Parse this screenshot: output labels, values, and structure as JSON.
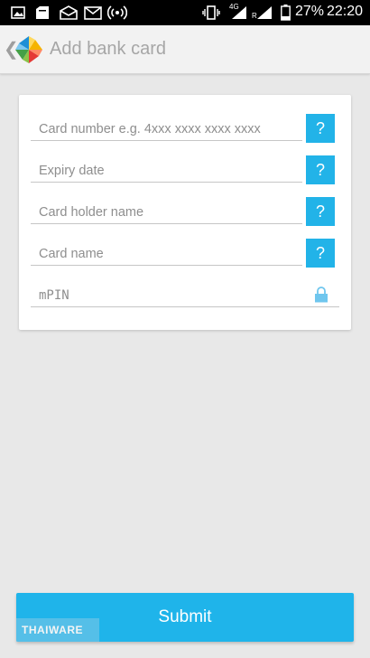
{
  "status_bar": {
    "icons": [
      "image-icon",
      "notification-icon",
      "mail-open-icon",
      "mail-icon",
      "hotspot-icon",
      "vibrate-icon",
      "signal-4g-icon",
      "signal-roaming-icon",
      "battery-icon"
    ],
    "net_4g": "4G",
    "roaming": "R",
    "battery": "27%",
    "time": "22:20"
  },
  "header": {
    "back_icon": "chevron-left-icon",
    "logo_icon": "pinwheel-logo-icon",
    "title": "Add bank card"
  },
  "form": {
    "fields": [
      {
        "placeholder": "Card number e.g. 4xxx xxxx xxxx xxxx",
        "help_label": "?"
      },
      {
        "placeholder": "Expiry date",
        "help_label": "?"
      },
      {
        "placeholder": "Card holder name",
        "help_label": "?"
      },
      {
        "placeholder": "Card name",
        "help_label": "?"
      }
    ],
    "pin": {
      "placeholder": "mPIN",
      "icon": "lock-icon"
    }
  },
  "submit_label": "Submit",
  "watermark": "THAIWARE",
  "colors": {
    "accent": "#22b3e8",
    "status_bar": "#000000",
    "app_bar": "#f2f2f2",
    "background": "#e8e8e8"
  }
}
